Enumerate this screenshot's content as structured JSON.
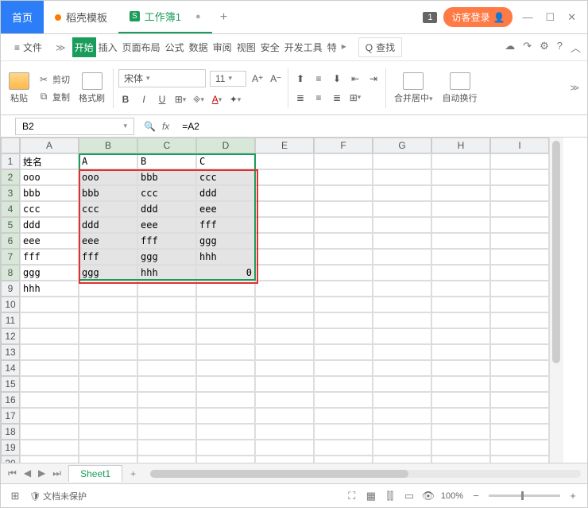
{
  "titlebar": {
    "tabs": [
      {
        "label": "首页",
        "kind": "home"
      },
      {
        "label": "稻壳模板",
        "kind": "orange"
      },
      {
        "label": "工作簿1",
        "kind": "green",
        "closable": true
      }
    ],
    "count": "1",
    "login": "访客登录"
  },
  "menu": {
    "file": "文件",
    "items": [
      "开始",
      "插入",
      "页面布局",
      "公式",
      "数据",
      "审阅",
      "视图",
      "安全",
      "开发工具",
      "特"
    ],
    "find": "查找"
  },
  "ribbon": {
    "paste": "粘贴",
    "cut": "剪切",
    "copy": "复制",
    "format_painter": "格式刷",
    "font": "宋体",
    "size": "11",
    "merge": "合并居中",
    "wrap": "自动换行"
  },
  "formula": {
    "namebox": "B2",
    "value": "=A2"
  },
  "columns": [
    "A",
    "B",
    "C",
    "D",
    "E",
    "F",
    "G",
    "H",
    "I"
  ],
  "rows_count": 20,
  "data": {
    "1": {
      "A": "姓名",
      "B": "A",
      "C": "B",
      "D": "C"
    },
    "2": {
      "A": "ooo",
      "B": "ooo",
      "C": "bbb",
      "D": "ccc"
    },
    "3": {
      "A": "bbb",
      "B": "bbb",
      "C": "ccc",
      "D": "ddd"
    },
    "4": {
      "A": "ccc",
      "B": "ccc",
      "C": "ddd",
      "D": "eee"
    },
    "5": {
      "A": "ddd",
      "B": "ddd",
      "C": "eee",
      "D": "fff"
    },
    "6": {
      "A": "eee",
      "B": "eee",
      "C": "fff",
      "D": "ggg"
    },
    "7": {
      "A": "fff",
      "B": "fff",
      "C": "ggg",
      "D": "hhh"
    },
    "8": {
      "A": "ggg",
      "B": "ggg",
      "C": "hhh",
      "D": "0"
    },
    "9": {
      "A": "hhh"
    }
  },
  "selection": {
    "cols": [
      "B",
      "C",
      "D"
    ],
    "rows": [
      2,
      3,
      4,
      5,
      6,
      7,
      8
    ]
  },
  "sheet": {
    "name": "Sheet1"
  },
  "status": {
    "protect": "文档未保护",
    "zoom": "100%"
  }
}
